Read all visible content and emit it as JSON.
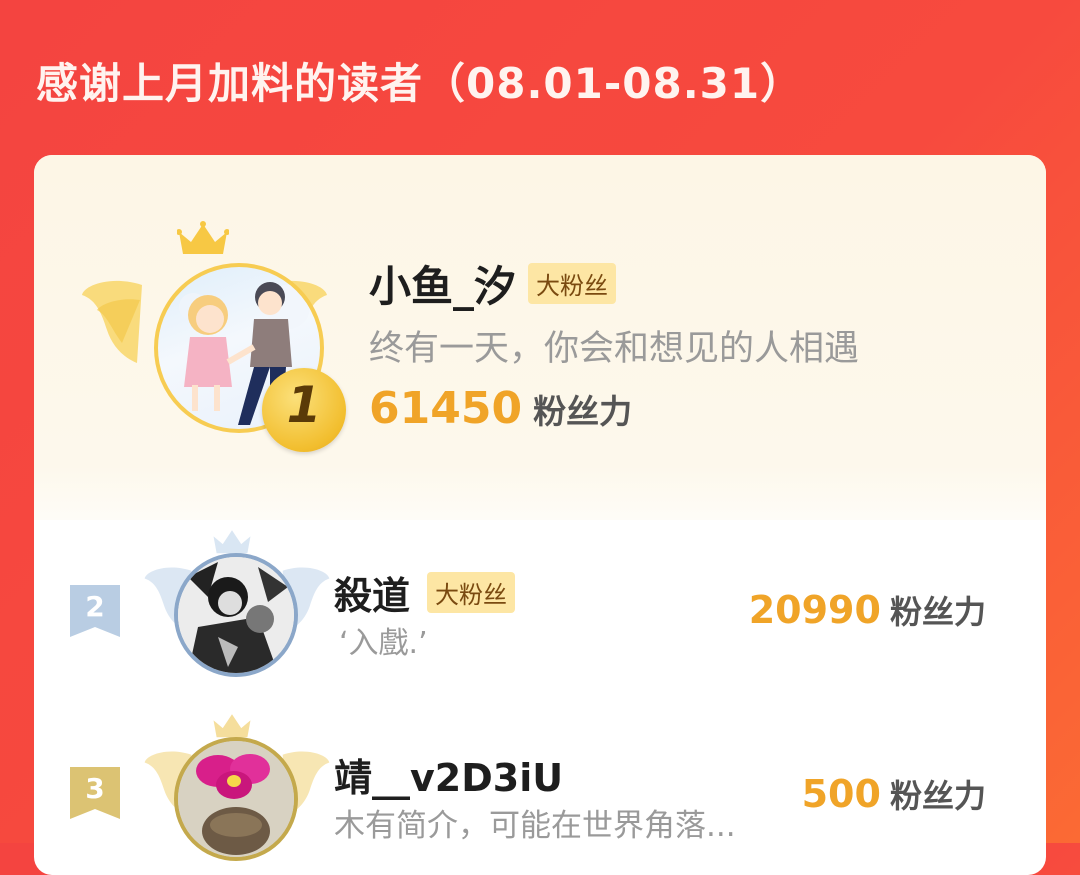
{
  "header": {
    "title": "感谢上月加料的读者（08.01-08.31）"
  },
  "colors": {
    "accent_orange": "#f0a428",
    "background_red": "#f44440",
    "badge_bg": "#fde6a4"
  },
  "readers": [
    {
      "rank": "1",
      "name": "小鱼_汐",
      "badge": "大粉丝",
      "bio": "终有一天，你会和想见的人相遇",
      "score": "61450",
      "score_unit": "粉丝力",
      "avatar_icon": "anime-couple-avatar"
    },
    {
      "rank": "2",
      "name": "殺道",
      "badge": "大粉丝",
      "bio": "‘入戲.’",
      "score": "20990",
      "score_unit": "粉丝力",
      "avatar_icon": "dark-character-avatar"
    },
    {
      "rank": "3",
      "name": "靖__v2D3iU",
      "bio": "木有简介，可能在世界角落...",
      "score": "500",
      "score_unit": "粉丝力",
      "avatar_icon": "orchid-flower-avatar"
    }
  ]
}
